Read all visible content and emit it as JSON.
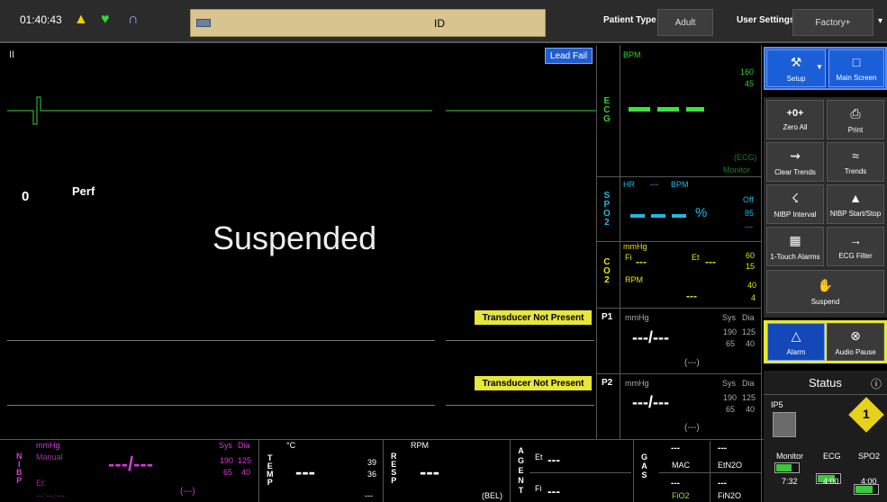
{
  "topbar": {
    "time": "01:40:43",
    "icons": [
      "bell-icon",
      "heart-icon",
      "lungs-icon"
    ],
    "id_label": "ID",
    "patient_type_label": "Patient Type",
    "patient_type_value": "Adult",
    "user_settings_label": "User Settings",
    "user_settings_value": "Factory+",
    "dropdown_glyph": "▾"
  },
  "waves": {
    "lead": "II",
    "lead_fail": "Lead Fail",
    "perf_value": "0",
    "perf_label": "Perf",
    "suspended": "Suspended",
    "transducer_p1": "Transducer Not Present",
    "transducer_p2": "Transducer Not Present"
  },
  "ecg": {
    "label": "E C G",
    "unit": "BPM",
    "hi": "160",
    "lo": "45",
    "source": "(ECG)",
    "mode": "Monitor"
  },
  "spo2": {
    "label": "S P O 2",
    "hr_label": "HR",
    "hr_value": "---",
    "hr_unit": "BPM",
    "unit": "%",
    "status": "Off",
    "limit": "85",
    "extra": "---"
  },
  "co2": {
    "label": "C O 2",
    "unit": "mmHg",
    "fi": "Fi",
    "fi_value": "---",
    "et": "Et",
    "et_value": "---",
    "hi": "60",
    "lo": "15",
    "rpm_label": "RPM",
    "rpm_hi": "40",
    "rpm_lo": "4",
    "rpm_value": "---"
  },
  "p1": {
    "label": "P1",
    "unit": "mmHg",
    "sys": "Sys",
    "dia": "Dia",
    "value": "---/---",
    "sys_hi": "190",
    "dia_hi": "125",
    "sys_lo": "65",
    "dia_lo": "40",
    "mean": "(---)"
  },
  "p2": {
    "label": "P2",
    "unit": "mmHg",
    "sys": "Sys",
    "dia": "Dia",
    "value": "---/---",
    "sys_hi": "190",
    "dia_hi": "125",
    "sys_lo": "65",
    "dia_lo": "40",
    "mean": "(---)"
  },
  "nibp": {
    "label": "N I B P",
    "unit": "mmHg",
    "mode": "Manual",
    "sys": "Sys",
    "dia": "Dia",
    "value": "---/---",
    "sys_hi": "190",
    "dia_hi": "125",
    "sys_lo": "65",
    "dia_lo": "40",
    "et_label": "Et:",
    "time": "---:---:---",
    "mean": "(---)"
  },
  "temp": {
    "label": "T E M P",
    "unit": "°C",
    "value": "---",
    "hi": "39",
    "lo": "36",
    "extra": "---"
  },
  "resp": {
    "label": "R E S P",
    "unit": "RPM",
    "value": "---",
    "source": "(BEL)"
  },
  "agent": {
    "label": "A G E N T",
    "et": "Et",
    "et_value": "---",
    "fi": "Fi",
    "fi_value": "---"
  },
  "gas": {
    "label": "G A S",
    "mac_value": "---",
    "mac": "MAC",
    "etn2o_value": "---",
    "etn2o": "EtN2O",
    "fio2_value": "---",
    "fio2": "FiO2",
    "fin2o_value": "---",
    "fin2o": "FiN2O"
  },
  "menu": {
    "setup": "Setup",
    "main_screen": "Main Screen",
    "zero_all": "Zero All",
    "zero_glyph": "+0+",
    "print": "Print",
    "clear_trends": "Clear Trends",
    "trends": "Trends",
    "nibp_interval": "NIBP Interval",
    "nibp_start_stop": "NIBP Start/Stop",
    "touch_alarms": "1-Touch Alarms",
    "ecg_filter": "ECG Filter",
    "suspend": "Suspend",
    "alarm": "Alarm",
    "audio_pause": "Audio Pause"
  },
  "status": {
    "title": "Status",
    "info_glyph": "ⓘ",
    "ip_label": "IP5",
    "warning_number": "1",
    "batteries": [
      {
        "label": "Monitor",
        "value": "7:32",
        "level": 0.7
      },
      {
        "label": "ECG",
        "value": "4:00",
        "level": 0.8
      },
      {
        "label": "SPO2",
        "value": "4:00",
        "level": 0.8
      }
    ]
  },
  "colors": {
    "ecg": "#2fd12f",
    "spo2": "#1fb8e6",
    "co2": "#e6e600",
    "nibp": "#d23cd2",
    "accent_blue": "#1b5fd8",
    "alarm_yellow": "#e7e63a"
  }
}
